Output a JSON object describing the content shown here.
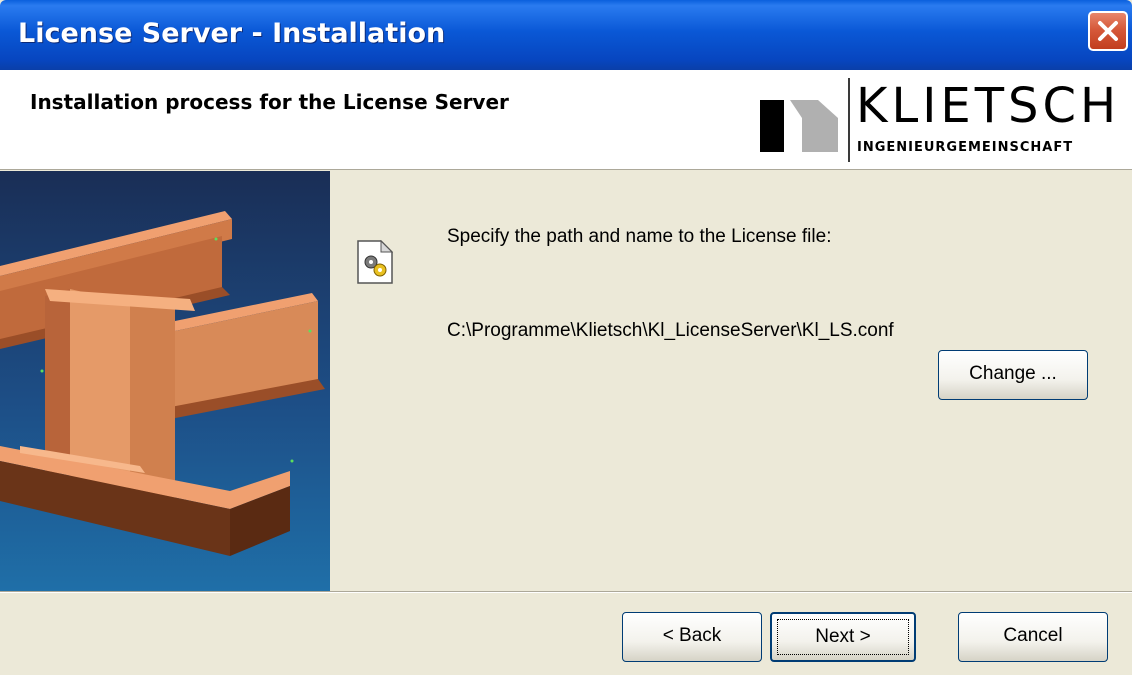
{
  "window": {
    "title": "License Server - Installation"
  },
  "header": {
    "title": "Installation process for the License Server",
    "logo": {
      "name": "KLIETSCH",
      "subtitle": "INGENIEURGEMEINSCHAFT"
    }
  },
  "content": {
    "prompt": "Specify the path and name to the License file:",
    "path": "C:\\Programme\\Klietsch\\Kl_LicenseServer\\Kl_LS.conf",
    "change_label": "Change ..."
  },
  "footer": {
    "back_label": "< Back",
    "next_label": "Next >",
    "cancel_label": "Cancel"
  },
  "icons": {
    "close": "close-icon",
    "file": "config-file-icon"
  },
  "colors": {
    "titlebar": "#0A58D6",
    "close_button": "#D6593A",
    "dialog_bg": "#ECE9D8",
    "beam": "#E0915F"
  }
}
